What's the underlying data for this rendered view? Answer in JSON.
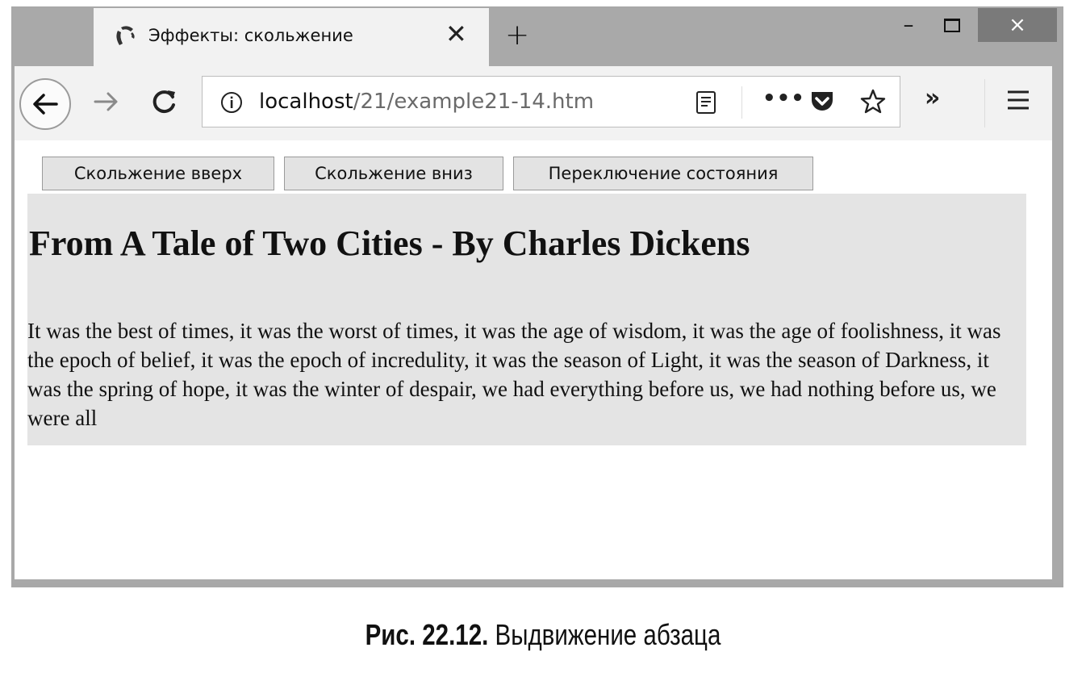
{
  "browser": {
    "tab_title": "Эффекты: скольжение",
    "tab_close": "✕",
    "new_tab": "+",
    "window_min": "–",
    "window_close": "×",
    "url_host": "localhost",
    "url_path": "/21/example21-14.htm",
    "dots": "•••",
    "overflow": "»"
  },
  "page": {
    "buttons": [
      {
        "label": "Скольжение вверх"
      },
      {
        "label": "Скольжение вниз"
      },
      {
        "label": "Переключение состояния"
      }
    ],
    "heading": "From A Tale of Two Cities - By Charles Dickens",
    "paragraph": "It was the best of times, it was the worst of times, it was the age of wisdom, it was the age of foolishness, it was the epoch of belief, it was the epoch of incredulity, it was the season of Light, it was the season of Darkness, it was the spring of hope, it was the winter of despair, we had everything before us, we had nothing before us, we were all"
  },
  "caption": {
    "label": "Рис. 22.12.",
    "text": "Выдвижение абзаца"
  }
}
